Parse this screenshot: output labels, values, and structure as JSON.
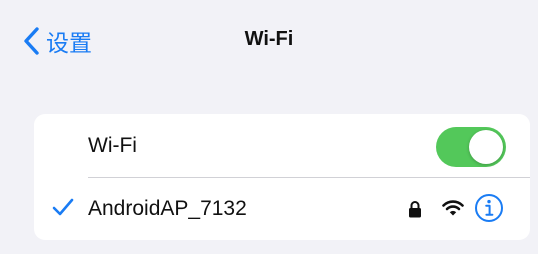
{
  "nav": {
    "back_label": "设置",
    "title": "Wi-Fi",
    "back_icon": "chevron-left-icon"
  },
  "wifi_toggle_row": {
    "label": "Wi-Fi",
    "toggle_on": true
  },
  "network": {
    "name": "AndroidAP_7132",
    "connected": true,
    "secured": true,
    "icons": [
      "checkmark-icon",
      "lock-icon",
      "wifi-signal-icon",
      "info-icon"
    ]
  },
  "colors": {
    "background": "#f2f2f7",
    "accent": "#1a7cf4",
    "toggle_on": "#53c85a",
    "cell": "#ffffff"
  }
}
